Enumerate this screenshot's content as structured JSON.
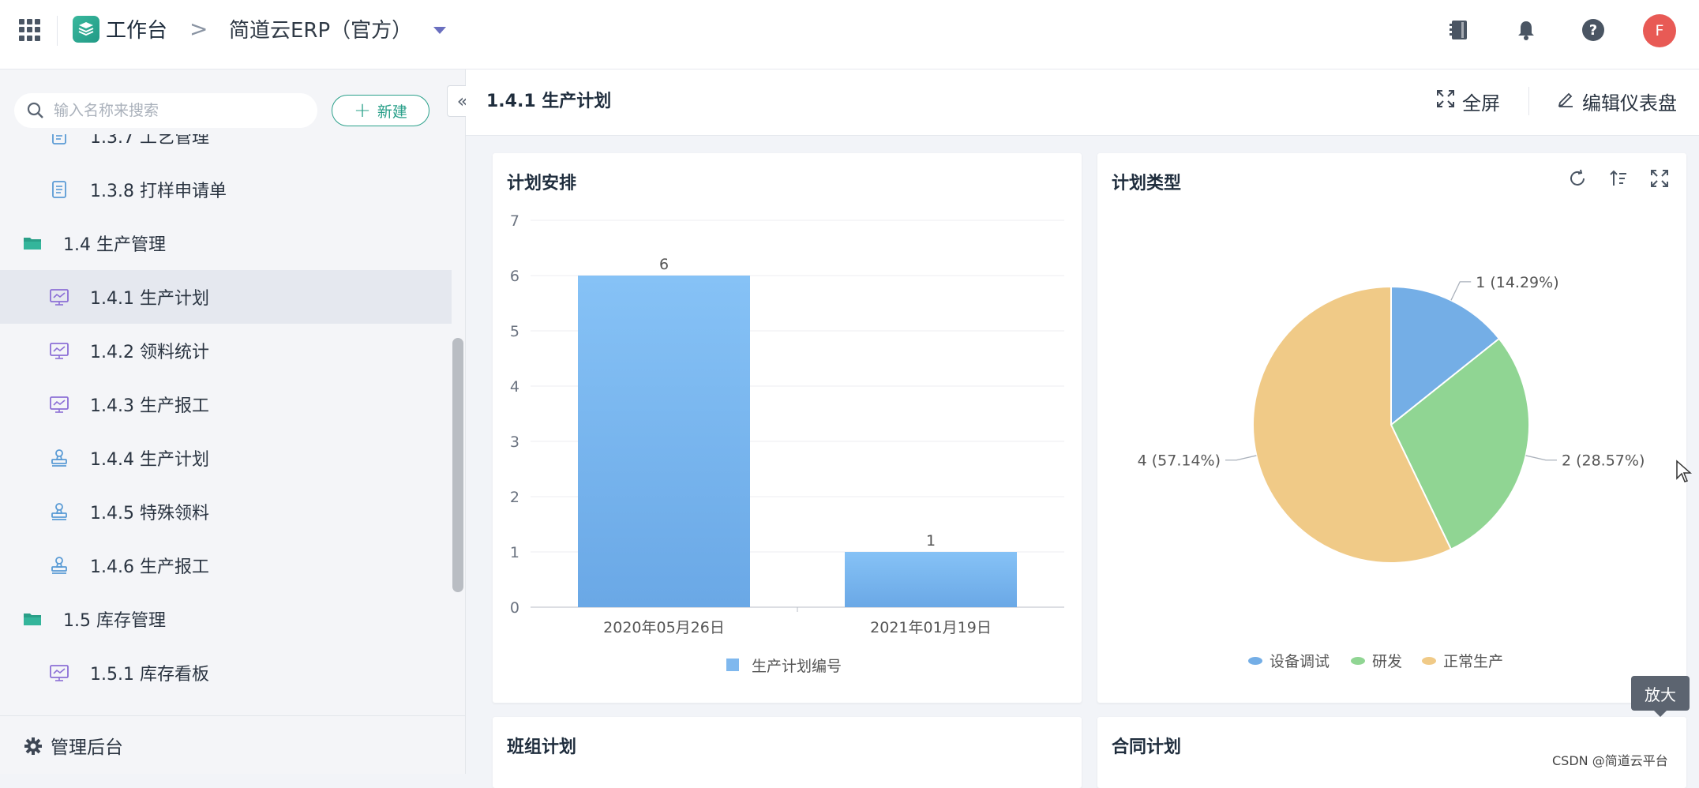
{
  "topbar": {
    "workspace_title": "工作台",
    "breadcrumb_separator": ">",
    "app_name": "简道云ERP（官方）",
    "avatar_initial": "F",
    "icons": [
      "apps-grid-icon",
      "workspace-logo-icon",
      "notebook-icon",
      "bell-icon",
      "help-icon"
    ]
  },
  "sidebar": {
    "search_placeholder": "输入名称来搜索",
    "new_button": "新建",
    "items": [
      {
        "label": "1.3.7 工艺管理",
        "icon": "form-icon",
        "indent": 2
      },
      {
        "label": "1.3.8 打样申请单",
        "icon": "form-icon",
        "indent": 2
      },
      {
        "label": "1.4 生产管理",
        "icon": "folder-icon",
        "indent": 1
      },
      {
        "label": "1.4.1 生产计划",
        "icon": "dashboard-icon",
        "indent": 2,
        "active": true
      },
      {
        "label": "1.4.2 领料统计",
        "icon": "dashboard-icon",
        "indent": 2
      },
      {
        "label": "1.4.3 生产报工",
        "icon": "dashboard-icon",
        "indent": 2
      },
      {
        "label": "1.4.4 生产计划",
        "icon": "stamp-icon",
        "indent": 2
      },
      {
        "label": "1.4.5 特殊领料",
        "icon": "stamp-icon",
        "indent": 2
      },
      {
        "label": "1.4.6 生产报工",
        "icon": "stamp-icon",
        "indent": 2
      },
      {
        "label": "1.5 库存管理",
        "icon": "folder-icon",
        "indent": 1
      },
      {
        "label": "1.5.1 库存看板",
        "icon": "dashboard-icon",
        "indent": 2
      }
    ],
    "admin_label": "管理后台"
  },
  "dashboard": {
    "title": "1.4.1 生产计划",
    "fullscreen_label": "全屏",
    "edit_label": "编辑仪表盘"
  },
  "cards": {
    "plan_schedule": {
      "title": "计划安排"
    },
    "plan_type": {
      "title": "计划类型",
      "tooltip": "放大"
    },
    "team_plan": {
      "title": "班组计划"
    },
    "contract_plan": {
      "title": "合同计划"
    }
  },
  "chart_data": [
    {
      "type": "bar",
      "title": "计划安排",
      "categories": [
        "2020年05月26日",
        "2021年01月19日"
      ],
      "series": [
        {
          "name": "生产计划编号",
          "values": [
            6,
            1
          ],
          "color": "#7fb8ee"
        }
      ],
      "ylim": [
        0,
        7
      ],
      "yticks": [
        0,
        1,
        2,
        3,
        4,
        5,
        6,
        7
      ],
      "grid": true,
      "legend": "bottom"
    },
    {
      "type": "pie",
      "title": "计划类型",
      "slices": [
        {
          "name": "设备调试",
          "value": 1,
          "label": "1 (14.29%)",
          "color": "#74aee6"
        },
        {
          "name": "研发",
          "value": 2,
          "label": "2 (28.57%)",
          "color": "#90d593"
        },
        {
          "name": "正常生产",
          "value": 4,
          "label": "4 (57.14%)",
          "color": "#f0ca87"
        }
      ],
      "legend": "bottom"
    }
  ],
  "footer": {
    "watermark": "CSDN @简道云平台"
  }
}
